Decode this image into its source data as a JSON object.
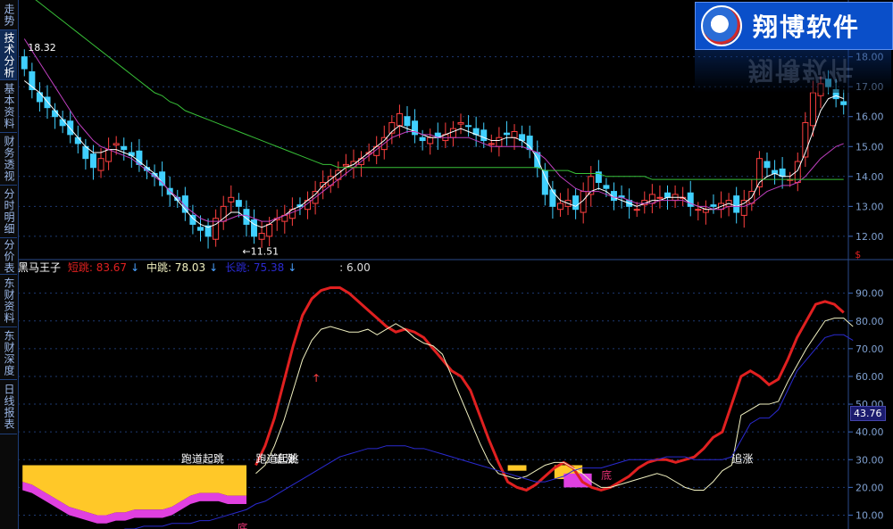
{
  "sidebar": {
    "tabs": [
      {
        "label": "走势",
        "active": false
      },
      {
        "label": "技术分析",
        "active": true
      },
      {
        "label": "基本资料",
        "active": false
      },
      {
        "label": "财务透视",
        "active": false
      },
      {
        "label": "分时明细",
        "active": false
      },
      {
        "label": "分价表",
        "active": false
      },
      {
        "label": "东财资料",
        "active": false
      },
      {
        "label": "东财深度",
        "active": false
      },
      {
        "label": "日线报表",
        "active": false
      }
    ]
  },
  "logo": {
    "text": "翔博软件"
  },
  "indicator": {
    "name": "黑马王子",
    "short_label": "短跳: 83.67",
    "mid_label": "中跳: 78.03",
    "long_label": "长跳: 75.38",
    "extra_label": ": 6.00",
    "colors": {
      "short": "#e02020",
      "mid": "#f0f0c0",
      "long": "#2a2ad0",
      "name": "#ffffff"
    }
  },
  "current_value_tag": "43.76",
  "chart_data": [
    {
      "type": "candlestick",
      "panel": "price",
      "y_ticks": [
        "18.00",
        "17.00",
        "16.00",
        "15.00",
        "14.00",
        "13.00",
        "12.00"
      ],
      "ylim": [
        11.4,
        19.6
      ],
      "annotations": [
        {
          "text": "18.32",
          "x": 0,
          "y": 18.32
        },
        {
          "text": "←11.51",
          "x": 28,
          "y": 11.51
        },
        {
          "text": "$",
          "x": 108,
          "y": 11.4,
          "color": "#e02020"
        }
      ],
      "closes": [
        17.6,
        16.9,
        16.5,
        16.3,
        16.0,
        15.7,
        15.4,
        15.1,
        14.6,
        14.3,
        14.6,
        14.9,
        15.1,
        14.9,
        14.7,
        14.4,
        14.2,
        14.0,
        13.7,
        13.4,
        13.2,
        12.8,
        12.4,
        12.2,
        12.0,
        12.6,
        13.0,
        13.3,
        13.0,
        12.4,
        12.0,
        12.1,
        12.4,
        12.6,
        12.7,
        12.9,
        13.0,
        13.2,
        13.5,
        13.8,
        14.0,
        14.2,
        14.4,
        14.5,
        14.6,
        14.8,
        15.0,
        15.3,
        15.8,
        16.1,
        15.7,
        15.4,
        15.2,
        15.3,
        15.3,
        15.4,
        15.6,
        15.8,
        15.7,
        15.4,
        15.2,
        15.1,
        15.3,
        15.4,
        15.5,
        15.2,
        14.9,
        14.3,
        13.4,
        13.0,
        13.1,
        13.2,
        12.9,
        13.5,
        14.0,
        13.8,
        13.6,
        13.2,
        13.3,
        13.0,
        12.9,
        13.2,
        13.4,
        13.3,
        13.3,
        13.4,
        13.3,
        13.0,
        12.9,
        12.9,
        13.0,
        13.1,
        13.2,
        12.8,
        13.2,
        13.5,
        14.6,
        14.3,
        14.1,
        14.0,
        13.9,
        14.5,
        15.8,
        16.8,
        17.1,
        17.0,
        16.6,
        16.4
      ],
      "series": [
        {
          "name": "MA-white",
          "color": "#ffffff",
          "values": [
            17.2,
            17.0,
            16.8,
            16.5,
            16.2,
            15.9,
            15.6,
            15.3,
            15.0,
            14.8,
            14.8,
            14.9,
            14.9,
            14.8,
            14.7,
            14.5,
            14.3,
            14.1,
            13.8,
            13.5,
            13.2,
            12.9,
            12.6,
            12.4,
            12.3,
            12.4,
            12.6,
            12.8,
            12.8,
            12.6,
            12.4,
            12.3,
            12.4,
            12.6,
            12.7,
            12.9,
            13.0,
            13.2,
            13.4,
            13.7,
            13.9,
            14.1,
            14.3,
            14.4,
            14.6,
            14.8,
            15.0,
            15.2,
            15.5,
            15.7,
            15.6,
            15.5,
            15.4,
            15.3,
            15.3,
            15.4,
            15.5,
            15.6,
            15.5,
            15.4,
            15.3,
            15.2,
            15.2,
            15.3,
            15.3,
            15.2,
            15.0,
            14.6,
            14.0,
            13.5,
            13.2,
            13.1,
            13.0,
            13.2,
            13.5,
            13.6,
            13.5,
            13.3,
            13.2,
            13.1,
            13.0,
            13.1,
            13.2,
            13.2,
            13.3,
            13.3,
            13.3,
            13.1,
            13.0,
            12.9,
            12.9,
            13.0,
            13.1,
            13.0,
            13.1,
            13.3,
            13.8,
            14.0,
            14.1,
            14.0,
            14.0,
            14.2,
            14.8,
            15.5,
            16.2,
            16.6,
            16.7,
            16.6
          ]
        },
        {
          "name": "MA-magenta",
          "color": "#c040c0",
          "values": [
            18.6,
            18.2,
            17.8,
            17.4,
            17.0,
            16.6,
            16.2,
            15.8,
            15.5,
            15.2,
            15.0,
            14.9,
            14.8,
            14.7,
            14.6,
            14.4,
            14.2,
            14.0,
            13.8,
            13.5,
            13.3,
            13.0,
            12.8,
            12.6,
            12.5,
            12.5,
            12.5,
            12.6,
            12.7,
            12.7,
            12.6,
            12.5,
            12.5,
            12.6,
            12.7,
            12.8,
            12.9,
            13.1,
            13.3,
            13.5,
            13.7,
            13.9,
            14.1,
            14.3,
            14.5,
            14.7,
            14.9,
            15.1,
            15.3,
            15.4,
            15.5,
            15.5,
            15.4,
            15.4,
            15.3,
            15.3,
            15.3,
            15.3,
            15.3,
            15.2,
            15.1,
            15.0,
            15.0,
            15.0,
            15.0,
            15.0,
            14.9,
            14.8,
            14.6,
            14.3,
            14.0,
            13.8,
            13.6,
            13.5,
            13.5,
            13.5,
            13.4,
            13.3,
            13.3,
            13.2,
            13.1,
            13.1,
            13.1,
            13.2,
            13.2,
            13.2,
            13.2,
            13.1,
            13.0,
            13.0,
            12.9,
            12.9,
            13.0,
            13.0,
            13.0,
            13.1,
            13.3,
            13.5,
            13.6,
            13.7,
            13.7,
            13.8,
            14.0,
            14.3,
            14.6,
            14.8,
            15.0,
            15.1
          ]
        },
        {
          "name": "MA-green",
          "color": "#38c038",
          "values": [
            20.2,
            20.0,
            19.8,
            19.6,
            19.4,
            19.2,
            19.0,
            18.8,
            18.6,
            18.4,
            18.2,
            18.0,
            17.8,
            17.6,
            17.4,
            17.2,
            17.0,
            16.8,
            16.7,
            16.5,
            16.4,
            16.2,
            16.1,
            16.0,
            15.9,
            15.8,
            15.7,
            15.6,
            15.5,
            15.4,
            15.3,
            15.2,
            15.1,
            15.0,
            14.9,
            14.8,
            14.7,
            14.6,
            14.5,
            14.4,
            14.4,
            14.3,
            14.3,
            14.3,
            14.3,
            14.3,
            14.3,
            14.3,
            14.3,
            14.3,
            14.3,
            14.3,
            14.3,
            14.3,
            14.3,
            14.3,
            14.3,
            14.3,
            14.3,
            14.3,
            14.3,
            14.3,
            14.3,
            14.3,
            14.3,
            14.3,
            14.3,
            14.3,
            14.2,
            14.2,
            14.2,
            14.2,
            14.1,
            14.1,
            14.1,
            14.1,
            14.0,
            14.0,
            14.0,
            14.0,
            14.0,
            14.0,
            13.9,
            13.9,
            13.9,
            13.9,
            13.9,
            13.9,
            13.9,
            13.9,
            13.9,
            13.9,
            13.9,
            13.9,
            13.9,
            13.9,
            13.9,
            13.9,
            13.9,
            13.9,
            13.9,
            13.9,
            13.9,
            13.9,
            13.9,
            13.9,
            13.9,
            13.9
          ]
        }
      ]
    },
    {
      "type": "line",
      "panel": "indicator",
      "y_ticks": [
        "90.00",
        "80.00",
        "70.00",
        "60.00",
        "50.00",
        "40.00",
        "30.00",
        "20.00",
        "10.00"
      ],
      "ylim": [
        5,
        96
      ],
      "annotations": [
        {
          "text": "跑道起跳",
          "x": 17,
          "y": 29,
          "color": "#ffffff"
        },
        {
          "text": "跑道起跳",
          "x": 25,
          "y": 29,
          "color": "#ffffff"
        },
        {
          "text": "追涨",
          "x": 27,
          "y": 29,
          "color": "#ffffff"
        },
        {
          "text": "追涨",
          "x": 76,
          "y": 29,
          "color": "#ffffff"
        },
        {
          "text": "底",
          "x": 62,
          "y": 23,
          "color": "#e03070"
        },
        {
          "text": "底",
          "x": 23,
          "y": 4,
          "color": "#e03070"
        },
        {
          "text": "↑",
          "x": 31,
          "y": 58,
          "color": "#ff4040"
        }
      ],
      "bands": [
        {
          "name": "yellow-zone",
          "color": "#ffc828",
          "x_start": 0,
          "x_end": 24,
          "top": 28,
          "bottom_values": [
            22,
            21,
            19,
            17,
            15,
            13,
            12,
            11,
            10,
            10,
            11,
            11,
            12,
            12,
            12,
            12,
            13,
            15,
            17,
            18,
            18,
            18,
            17,
            17,
            17
          ]
        },
        {
          "name": "magenta-zone",
          "color": "#e040e0",
          "x_start": 0,
          "x_end": 24,
          "bottom_offset": 3
        },
        {
          "name": "yellow-zone-2",
          "color": "#ffc828",
          "x_start": 52,
          "x_end": 54,
          "top": 28,
          "bottom": 26
        },
        {
          "name": "yellow-zone-3",
          "color": "#ffc828",
          "x_start": 57,
          "x_end": 60,
          "top": 28,
          "bottom": 23
        },
        {
          "name": "magenta-zone-3",
          "color": "#e040e0",
          "x_start": 58,
          "x_end": 61,
          "top": 25,
          "bottom": 20
        }
      ],
      "series": [
        {
          "name": "短跳",
          "color": "#e02020",
          "width": 3,
          "values": [
            null,
            null,
            null,
            null,
            null,
            null,
            null,
            null,
            null,
            null,
            null,
            null,
            null,
            null,
            null,
            null,
            null,
            null,
            null,
            null,
            null,
            null,
            null,
            null,
            null,
            28,
            35,
            45,
            58,
            71,
            82,
            88,
            91,
            92,
            92,
            90,
            87,
            84,
            81,
            78,
            76,
            77,
            76,
            74,
            70,
            66,
            62,
            60,
            55,
            46,
            37,
            29,
            22,
            20,
            19,
            21,
            24,
            27,
            29,
            27,
            22,
            20,
            19,
            20,
            22,
            24,
            27,
            29,
            30,
            30,
            29,
            30,
            31,
            34,
            38,
            40,
            50,
            60,
            62,
            60,
            57,
            59,
            66,
            74,
            80,
            86,
            87,
            86,
            83
          ]
        },
        {
          "name": "中跳",
          "color": "#f0f0c0",
          "width": 1,
          "values": [
            null,
            null,
            null,
            null,
            null,
            null,
            null,
            null,
            null,
            null,
            null,
            null,
            null,
            null,
            null,
            null,
            null,
            null,
            null,
            null,
            null,
            null,
            null,
            null,
            null,
            25,
            28,
            35,
            44,
            55,
            66,
            73,
            77,
            78,
            77,
            76,
            76,
            77,
            75,
            77,
            79,
            77,
            74,
            72,
            71,
            68,
            60,
            52,
            44,
            36,
            29,
            25,
            24,
            23,
            24,
            26,
            28,
            29,
            29,
            27,
            25,
            22,
            20,
            20,
            21,
            22,
            23,
            24,
            25,
            24,
            22,
            20,
            19,
            19,
            22,
            26,
            28,
            46,
            48,
            50,
            50,
            51,
            58,
            64,
            70,
            75,
            80,
            81,
            81,
            78
          ]
        },
        {
          "name": "长跳",
          "color": "#2a2ad0",
          "width": 1,
          "values": [
            2,
            2,
            2,
            2,
            3,
            3,
            3,
            4,
            4,
            4,
            4,
            5,
            5,
            6,
            6,
            6,
            7,
            7,
            7,
            8,
            8,
            9,
            10,
            11,
            12,
            14,
            15,
            17,
            19,
            21,
            23,
            25,
            27,
            29,
            31,
            32,
            33,
            34,
            34,
            35,
            35,
            35,
            34,
            34,
            33,
            32,
            31,
            30,
            29,
            28,
            27,
            26,
            25,
            24,
            23,
            22,
            22,
            23,
            24,
            26,
            27,
            27,
            27,
            28,
            29,
            30,
            30,
            30,
            30,
            31,
            31,
            31,
            30,
            30,
            30,
            30,
            31,
            37,
            43,
            45,
            45,
            48,
            55,
            62,
            66,
            70,
            74,
            75,
            75,
            73
          ]
        }
      ]
    }
  ]
}
